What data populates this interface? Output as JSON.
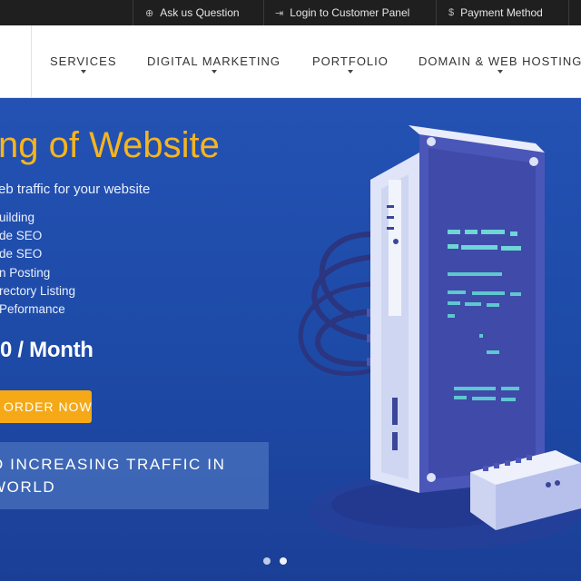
{
  "topbar": {
    "items": [
      {
        "icon": "globe-icon",
        "label": "Ask us Question"
      },
      {
        "icon": "login-icon",
        "label": "Login to Customer Panel"
      },
      {
        "icon": "dollar-icon",
        "label": "Payment Method"
      }
    ]
  },
  "nav": {
    "items": [
      "SERVICES",
      "DIGITAL MARKETING",
      "PORTFOLIO",
      "DOMAIN & WEB HOSTING"
    ]
  },
  "hero": {
    "title": "ng of Website",
    "subtitle": "eb traffic for your website",
    "features": [
      "uilding",
      "de SEO",
      "de SEO",
      "n Posting",
      "rectory Listing",
      " Peformance"
    ],
    "price": "0 / Month",
    "order_label": "ORDER NOW",
    "banner_line1": "O INCREASING TRAFFIC IN",
    "banner_line2": "WORLD",
    "slides": {
      "count": 2,
      "active": 2
    }
  },
  "colors": {
    "hero_bg": "#2452b4",
    "accent": "#f5b51e",
    "button": "#f5a916",
    "topbar_bg": "#1f1f1f"
  }
}
